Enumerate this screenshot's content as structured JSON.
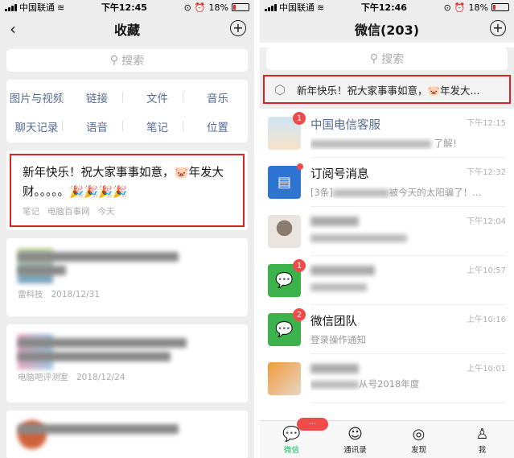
{
  "status_left": {
    "carrier": "中国联通",
    "time": "下午12:45",
    "battery": "18%"
  },
  "status_right": {
    "carrier": "中国联通",
    "time": "下午12:46",
    "battery": "18%"
  },
  "favorites": {
    "title": "收藏",
    "search_placeholder": "搜索",
    "categories": [
      "图片与视频",
      "链接",
      "文件",
      "音乐",
      "聊天记录",
      "语音",
      "笔记",
      "位置"
    ],
    "highlighted_item": {
      "text": "新年快乐！祝大家事事如意，🐷年发大财。。。。。🎉🎉🎉🎉",
      "type": "笔记",
      "source": "电脑百事网",
      "time": "今天"
    },
    "items": [
      {
        "source": "雷科技",
        "date": "2018/12/31"
      },
      {
        "source": "电脑吧评测室",
        "date": "2018/12/24"
      }
    ]
  },
  "chats": {
    "title": "微信(203)",
    "search_placeholder": "搜索",
    "pinned_note": "新年快乐！祝大家事事如意，🐷年发大...",
    "conversations": [
      {
        "name": "中国电信客服",
        "preview": "了解！",
        "time": "下午12:15",
        "badge": "1",
        "name_color": "#576b95",
        "avatar": "telecom"
      },
      {
        "name": "订阅号消息",
        "preview": "[3条]",
        "preview_tail": "被今天的太阳骗了！...",
        "time": "下午12:32",
        "badge": "",
        "dot": true,
        "avatar": "subscription-icon"
      },
      {
        "name": "",
        "preview": "",
        "time": "下午12:04",
        "badge": "",
        "avatar": "photo"
      },
      {
        "name": "",
        "preview": "",
        "time": "上午10:57",
        "badge": "1",
        "avatar": "chat-green"
      },
      {
        "name": "微信团队",
        "preview": "登录操作通知",
        "time": "上午10:16",
        "badge": "2",
        "avatar": "chat-green"
      },
      {
        "name": "",
        "preview": "从号2018年度",
        "time": "上午10:01",
        "badge": "",
        "avatar": "orange"
      }
    ],
    "tabs": [
      "微信",
      "通讯录",
      "发现",
      "我"
    ],
    "tab_badge": "···"
  },
  "colors": {
    "accent_green": "#07c160",
    "link_blue": "#576b95",
    "highlight_red": "#d92325",
    "badge_red": "#f04b4b"
  }
}
